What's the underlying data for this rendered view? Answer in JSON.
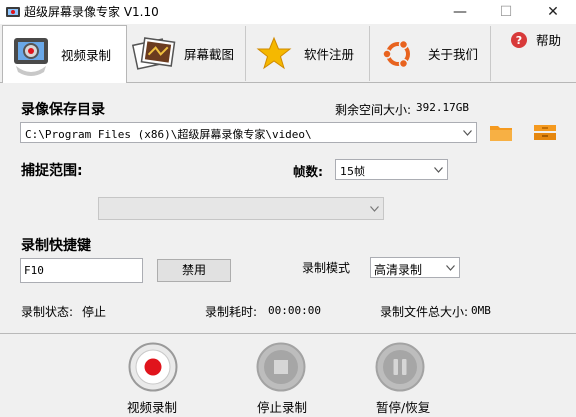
{
  "window": {
    "title": "超级屏幕录像专家 V1.10",
    "minimize": "—",
    "maximize": "☐",
    "close": "✕"
  },
  "tabs": [
    {
      "label": "视频录制",
      "icon": "video-recorder-icon"
    },
    {
      "label": "屏幕截图",
      "icon": "photo-icon"
    },
    {
      "label": "软件注册",
      "icon": "star-icon"
    },
    {
      "label": "关于我们",
      "icon": "ubuntu-logo-icon"
    }
  ],
  "help": {
    "label": "帮助",
    "icon": "help-icon"
  },
  "save": {
    "label": "录像保存目录",
    "free_space_label": "剩余空间大小:",
    "free_space_value": "392.17GB",
    "path": "C:\\Program Files (x86)\\超级屏幕录像专家\\video\\"
  },
  "capture": {
    "label": "捕捉范围:",
    "region_value": ""
  },
  "fps": {
    "label": "帧数:",
    "value": "15帧"
  },
  "hotkey": {
    "label": "录制快捷键",
    "value": "F10",
    "disable_label": "禁用"
  },
  "mode": {
    "label": "录制模式",
    "value": "高清录制"
  },
  "status": {
    "state_label": "录制状态:",
    "state_value": "停止",
    "elapsed_label": "录制耗时:",
    "elapsed_value": "00:00:00",
    "size_label": "录制文件总大小:",
    "size_value": "0MB"
  },
  "controls": {
    "record_label": "视频录制",
    "stop_label": "停止录制",
    "pause_label": "暂停/恢复"
  },
  "colors": {
    "record_red": "#e0141c",
    "folder_orange": "#f59a1f",
    "panel_bg": "#f0f0f0",
    "disabled_gray": "#9a9a9a"
  }
}
